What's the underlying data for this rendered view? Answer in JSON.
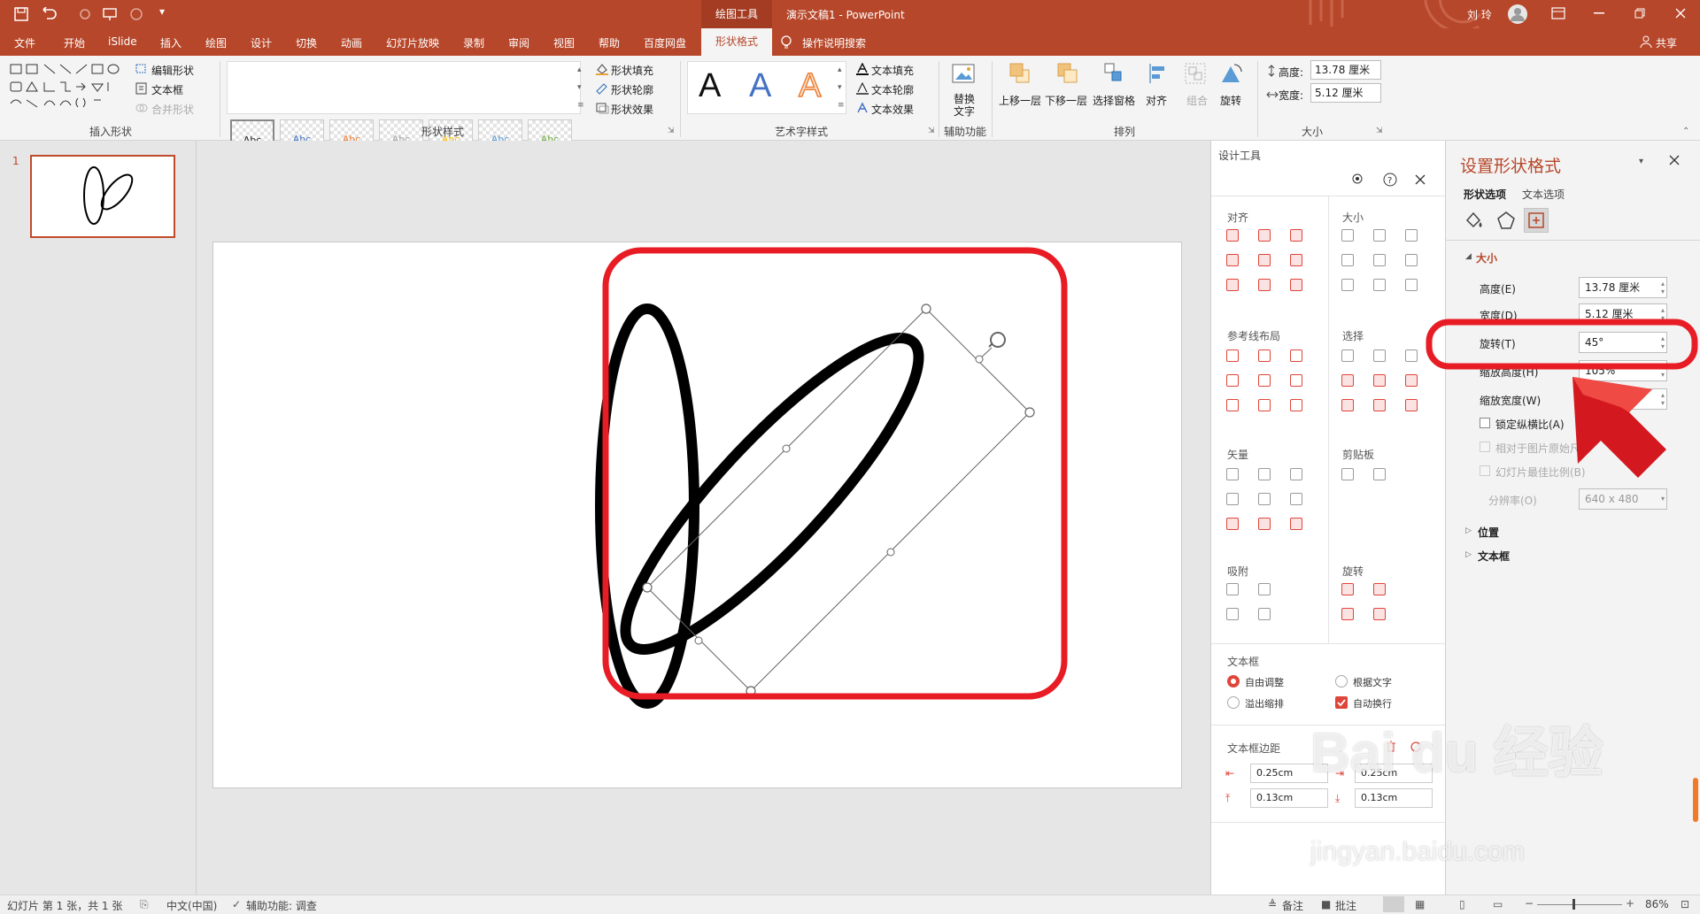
{
  "titlebar": {
    "context_group": "绘图工具",
    "doc_title": "演示文稿1 - PowerPoint",
    "user": "刘 玲"
  },
  "tabs": [
    "文件",
    "开始",
    "iSlide",
    "插入",
    "绘图",
    "设计",
    "切换",
    "动画",
    "幻灯片放映",
    "录制",
    "审阅",
    "视图",
    "帮助",
    "百度网盘"
  ],
  "active_tab": "形状格式",
  "tell_me": "操作说明搜索",
  "share": "共享",
  "ribbon": {
    "insert_shapes": {
      "label": "插入形状",
      "edit_shape": "编辑形状",
      "text_box": "文本框",
      "merge_shapes": "合并形状"
    },
    "shape_styles": {
      "label": "形状样式",
      "swatch_text": "Abc",
      "fill": "形状填充",
      "outline": "形状轮廓",
      "effects": "形状效果"
    },
    "wordart": {
      "label": "艺术字样式",
      "text_fill": "文本填充",
      "text_outline": "文本轮廓",
      "text_effects": "文本效果",
      "letter": "A"
    },
    "accessibility": {
      "label": "辅助功能",
      "alt_text_1": "替换",
      "alt_text_2": "文字"
    },
    "arrange": {
      "label": "排列",
      "bring_forward": "上移一层",
      "send_backward": "下移一层",
      "selection_pane": "选择窗格",
      "align": "对齐",
      "group": "组合",
      "rotate": "旋转"
    },
    "size": {
      "label": "大小",
      "height_label": "高度:",
      "height_value": "13.78 厘米",
      "width_label": "宽度:",
      "width_value": "5.12 厘米"
    }
  },
  "thumbnail": {
    "number": "1"
  },
  "design_panel": {
    "title": "设计工具",
    "sections": {
      "align": "对齐",
      "size": "大小",
      "guides": "参考线布局",
      "select": "选择",
      "vector": "矢量",
      "clipboard": "剪贴板",
      "snap": "吸附",
      "rotate": "旋转",
      "textbox": "文本框",
      "margins": "文本框边距"
    },
    "textbox_options": {
      "auto_adjust": "自由调整",
      "fit_text": "根据文字",
      "overflow": "溢出缩排",
      "auto_wrap": "自动换行"
    },
    "margins": {
      "left": "0.25cm",
      "right": "0.25cm",
      "top": "0.13cm",
      "bottom": "0.13cm"
    }
  },
  "format_panel": {
    "title": "设置形状格式",
    "tabs": {
      "shape_options": "形状选项",
      "text_options": "文本选项"
    },
    "size_section": "大小",
    "height_label": "高度(E)",
    "height_value": "13.78 厘米",
    "width_label": "宽度(D)",
    "width_value": "5.12 厘米",
    "rotation_label": "旋转(T)",
    "rotation_value": "45°",
    "scale_height_label": "缩放高度(H)",
    "scale_height_value": "105%",
    "scale_width_label": "缩放宽度(W)",
    "scale_width_value": "",
    "lock_aspect": "锁定纵横比(A)",
    "relative_original": "相对于图片原始尺寸(R)",
    "best_scale": "幻灯片最佳比例(B)",
    "resolution_label": "分辨率(O)",
    "resolution_value": "640 x 480",
    "position_section": "位置",
    "textbox_section": "文本框"
  },
  "statusbar": {
    "slide_info": "幻灯片 第 1 张，共 1 张",
    "language": "中文(中国)",
    "accessibility": "辅助功能: 调查",
    "notes": "备注",
    "comments": "批注",
    "zoom": "86%"
  },
  "watermark": {
    "brand": "Bai du 经验",
    "url": "jingyan.baidu.com"
  },
  "colors": {
    "accent": "#b7472a",
    "annotation_red": "#e81c24"
  }
}
